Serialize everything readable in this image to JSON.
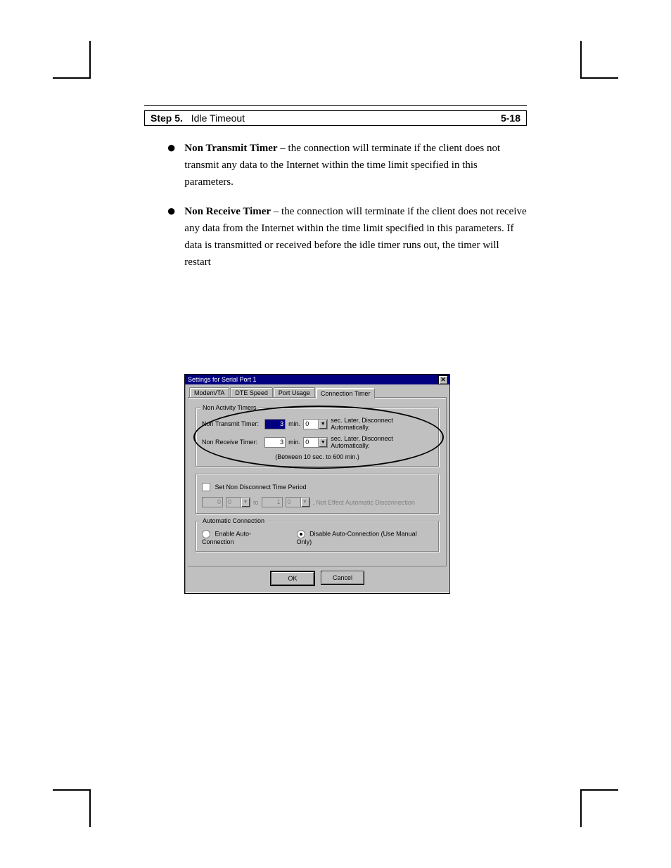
{
  "page": {
    "step_label": "Step 5.",
    "step_text": "Idle Timeout",
    "page_no": "5-18",
    "bullets": [
      {
        "bold": "Non Transmit Timer",
        "rest": " – the connection will terminate if the client does not transmit any data to the Internet within the time limit specified in this parameters."
      },
      {
        "bold": "Non Receive Timer",
        "rest": " – the connection will terminate if the client does not receive any data from the Internet within the time limit specified in this parameters. If data is transmitted or received before the idle timer runs out, the timer will restart"
      }
    ]
  },
  "dialog": {
    "title": "Settings for Serial Port 1",
    "tabs": [
      "Modem/TA",
      "DTE Speed",
      "Port Usage",
      "Connection Timer"
    ],
    "active_tab": 3,
    "group_timers_title": "Non Activity Timers",
    "non_transmit": {
      "label": "Non Transmit Timer:",
      "min": "3",
      "min_selected": true,
      "unit_min": "min.",
      "sec": "0",
      "unit_sec_suffix": "sec. Later, Disconnect Automatically."
    },
    "non_receive": {
      "label": "Non Receive Timer:",
      "min": "3",
      "unit_min": "min.",
      "sec": "0",
      "unit_sec_suffix": "sec. Later, Disconnect Automatically."
    },
    "range_hint": "(Between 10 sec. to 600 min.)",
    "non_disconnect_label": "Set Non Disconnect Time Period",
    "non_disconnect_row": {
      "from_h": "0",
      "from_m": "0",
      "to_sep": "to",
      "to_h": "1",
      "to_m": "0",
      "tail": ", Not Effect Automatic Disconnection"
    },
    "group_auto_title": "Automatic Connection",
    "radio_enable": "Enable Auto-Connection",
    "radio_disable": "Disable Auto-Connection (Use Manual Only)",
    "radio_selected": "disable",
    "ok": "OK",
    "cancel": "Cancel"
  }
}
